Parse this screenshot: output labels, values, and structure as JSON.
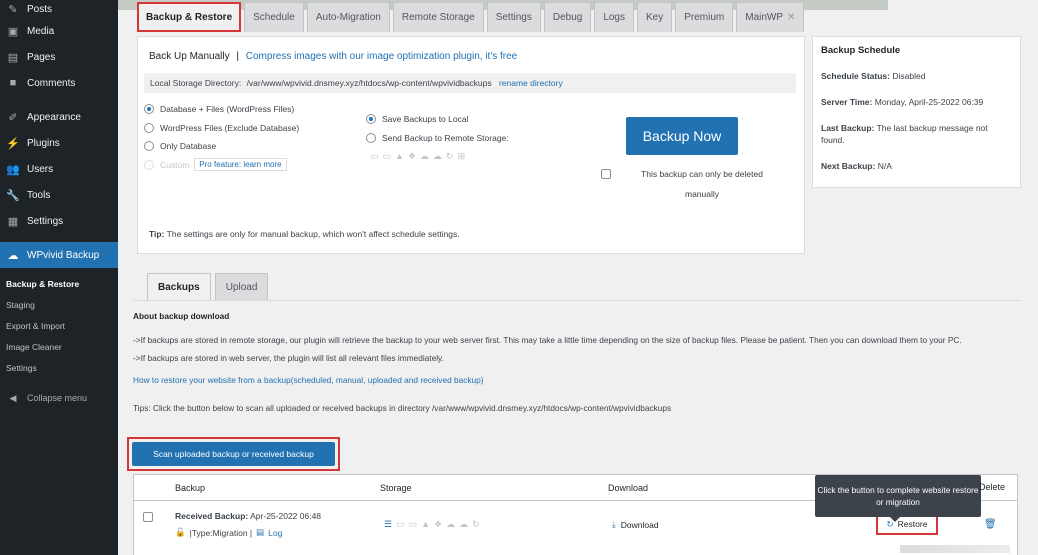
{
  "sidebar": {
    "items": [
      {
        "label": "Posts",
        "icon": "pin-icon"
      },
      {
        "label": "Media",
        "icon": "media-icon"
      },
      {
        "label": "Pages",
        "icon": "pages-icon"
      },
      {
        "label": "Comments",
        "icon": "comments-icon"
      },
      {
        "label": "Appearance",
        "icon": "brush-icon"
      },
      {
        "label": "Plugins",
        "icon": "plugin-icon"
      },
      {
        "label": "Users",
        "icon": "users-icon"
      },
      {
        "label": "Tools",
        "icon": "wrench-icon"
      },
      {
        "label": "Settings",
        "icon": "settings-icon"
      },
      {
        "label": "WPvivid Backup",
        "icon": "cloud-icon"
      }
    ],
    "sub": [
      "Backup & Restore",
      "Staging",
      "Export & Import",
      "Image Cleaner",
      "Settings"
    ],
    "collapse": "Collapse menu"
  },
  "tabs": [
    "Backup & Restore",
    "Schedule",
    "Auto-Migration",
    "Remote Storage",
    "Settings",
    "Debug",
    "Logs",
    "Key",
    "Premium",
    "MainWP"
  ],
  "manual": {
    "title": "Back Up Manually",
    "sep": "|",
    "link": "Compress images with our image optimization plugin, it's free",
    "dir_label": "Local Storage Directory:",
    "dir_path": "/var/www/wpvivid.dnsmey.xyz/htdocs/wp-content/wpvividbackups",
    "dir_link": "rename directory",
    "options": [
      "Database + Files (WordPress Files)",
      "WordPress Files (Exclude Database)",
      "Only Database",
      "Custom"
    ],
    "pro": "Pro feature: learn more",
    "dest": [
      "Save Backups to Local",
      "Send Backup to Remote Storage:"
    ],
    "backup_now": "Backup Now",
    "only_delete": "This backup can only be deleted manually",
    "tip_bold": "Tip:",
    "tip": "The settings are only for manual backup, which won't affect schedule settings."
  },
  "schedule": {
    "title": "Backup Schedule",
    "status_label": "Schedule Status:",
    "status": "Disabled",
    "time_label": "Server Time:",
    "time": "Monday, April-25-2022 06:39",
    "last_label": "Last Backup:",
    "last": "The last backup message not found.",
    "next_label": "Next Backup:",
    "next": "N/A"
  },
  "backup_tabs": [
    "Backups",
    "Upload"
  ],
  "about": {
    "heading": "About backup download",
    "p1": "->If backups are stored in remote storage, our plugin will retrieve the backup to your web server first. This may take a little time depending on the size of backup files. Please be patient. Then you can download them to your PC.",
    "p2": "->If backups are stored in web server, the plugin will list all relevant files immediately.",
    "link": "How to restore your website from a backup(scheduled, manual, uploaded and received backup)",
    "tip": "Tips: Click the button below to scan all uploaded or received backups in directory /var/www/wpvivid.dnsmey.xyz/htdocs/wp-content/wpvividbackups"
  },
  "scan_button": "Scan uploaded backup or received backup",
  "table": {
    "headers": [
      "Backup",
      "Storage",
      "Download",
      "Delete"
    ],
    "row": {
      "title_bold": "Received Backup:",
      "title": "Apr-25-2022 06:48",
      "type": "|Type:Migration |",
      "log": "Log",
      "download": "Download",
      "restore": "Restore"
    }
  },
  "tooltip": "Click the button to complete website restore or migration"
}
